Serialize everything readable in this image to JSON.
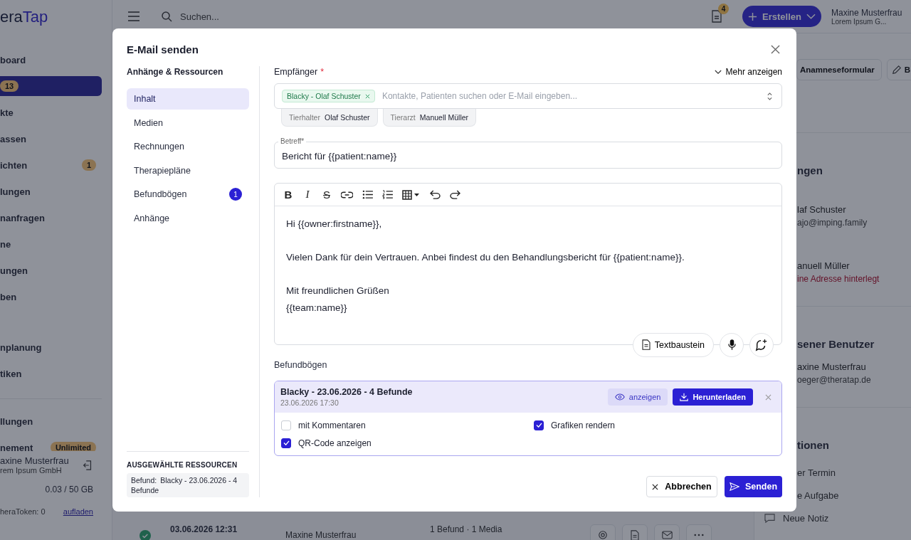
{
  "app": {
    "logo": {
      "dark": "era",
      "accent": "Tap"
    },
    "sidebar": {
      "groups": [
        [
          {
            "label": "board",
            "selected": false
          },
          {
            "selected": true,
            "badge": "13"
          },
          {
            "label": "kte",
            "selected": false
          },
          {
            "label": "assen",
            "selected": false
          },
          {
            "label": "ichten",
            "selected": false,
            "badge": "1"
          },
          {
            "label": "lungen",
            "selected": false
          },
          {
            "label": "nanfragen",
            "selected": false
          },
          {
            "label": "ne",
            "selected": false
          },
          {
            "label": "ungen",
            "selected": false
          },
          {
            "label": "ben",
            "selected": false
          }
        ],
        [
          {
            "label": "nplanung",
            "selected": false
          },
          {
            "label": "tiken",
            "selected": false
          }
        ],
        [
          {
            "label": "llungen",
            "selected": false
          },
          {
            "label": "nement",
            "selected": false,
            "badge": "Unlimited"
          }
        ]
      ],
      "user": {
        "name": "axine Musterfrau",
        "org": "rem Ipsum GmbH"
      },
      "storage": "0.03 / 50 GB",
      "tokens": "heraToken: 0",
      "topup": "aufladen"
    },
    "topbar": {
      "search_placeholder": "Suchen...",
      "notification_count": "4",
      "create_button": "Erstellen",
      "user": {
        "name": "Maxine Musterfrau",
        "org": "Lorem Ipsum G..."
      }
    },
    "right_panel": {
      "buttons": [
        {
          "label": "Anamneseformular"
        },
        {
          "label": "B"
        }
      ],
      "sections": [
        {
          "heading": "ngen",
          "people": [
            {
              "name": "laf Schuster",
              "detail": "ajo@imping.family",
              "missing": false
            },
            {
              "name": "anuell Müller",
              "detail": "ine Adresse hinterlegt",
              "missing": true
            }
          ]
        },
        {
          "heading": "sener Benutzer",
          "people": [
            {
              "name": "axine Musterfrau",
              "detail": "oeger@theratap.de",
              "missing": false
            }
          ]
        },
        {
          "heading": "tionen",
          "actions": [
            "er Termin",
            "e Aufgabe",
            "Neue Notiz"
          ]
        }
      ]
    },
    "bottom_row": {
      "date": "03.06.2026 12:31",
      "person": "Maxine Musterfrau",
      "summary": "1 Befund · 1 Media"
    }
  },
  "modal": {
    "title": "E-Mail senden",
    "nav_heading": "Anhänge & Ressourcen",
    "tabs": [
      {
        "label": "Inhalt",
        "selected": true
      },
      {
        "label": "Medien",
        "selected": false
      },
      {
        "label": "Rechnungen",
        "selected": false
      },
      {
        "label": "Therapiepläne",
        "selected": false
      },
      {
        "label": "Befundbögen",
        "selected": false,
        "badge": "1"
      },
      {
        "label": "Anhänge",
        "selected": false
      }
    ],
    "selected_resources": {
      "heading": "AUSGEWÄHLTE RESSOURCEN",
      "items": [
        {
          "label": "Befund:",
          "text": "Blacky - 23.06.2026 - 4 Befunde"
        }
      ]
    },
    "recipients": {
      "label": "Empfänger",
      "required_mark": "*",
      "more": "Mehr anzeigen",
      "chips": [
        "Blacky - Olaf Schuster"
      ],
      "placeholder": "Kontakte, Patienten suchen oder E-Mail eingeben...",
      "roles": [
        {
          "role": "Tierhalter",
          "name": "Olaf Schuster"
        },
        {
          "role": "Tierarzt",
          "name": "Manuell Müller"
        }
      ]
    },
    "subject": {
      "label": "Betreff*",
      "value": "Bericht für {{patient:name}}"
    },
    "editor": {
      "toolbar": [
        {
          "kind": "bold",
          "glyph": "B"
        },
        {
          "kind": "italic",
          "glyph": "I"
        },
        {
          "kind": "strike",
          "glyph": "S"
        },
        {
          "kind": "link"
        },
        {
          "kind": "bullets"
        },
        {
          "kind": "numbers"
        },
        {
          "kind": "table"
        },
        {
          "kind": "undo"
        },
        {
          "kind": "redo"
        }
      ],
      "paragraphs": [
        [
          "Hi {{owner:firstname}},"
        ],
        [
          "Vielen Dank für dein Vertrauen. Anbei findest du den Behandlungsbericht für {{patient:name}}."
        ],
        [
          "Mit freundlichen Grüßen",
          "{{team:name}}"
        ]
      ],
      "snippet_button": "Textbaustein"
    },
    "findings": {
      "label": "Befundbögen",
      "items": [
        {
          "title": "Blacky - 23.06.2026 - 4 Befunde",
          "date": "23.06.2026 17:30",
          "view": "anzeigen",
          "download": "Herunterladen",
          "options": [
            {
              "label": "mit Kommentaren",
              "checked": false
            },
            {
              "label": "Grafiken rendern",
              "checked": true
            },
            {
              "label": "QR-Code anzeigen",
              "checked": true
            }
          ]
        }
      ]
    },
    "cancel": "Abbrechen",
    "send": "Senden"
  }
}
